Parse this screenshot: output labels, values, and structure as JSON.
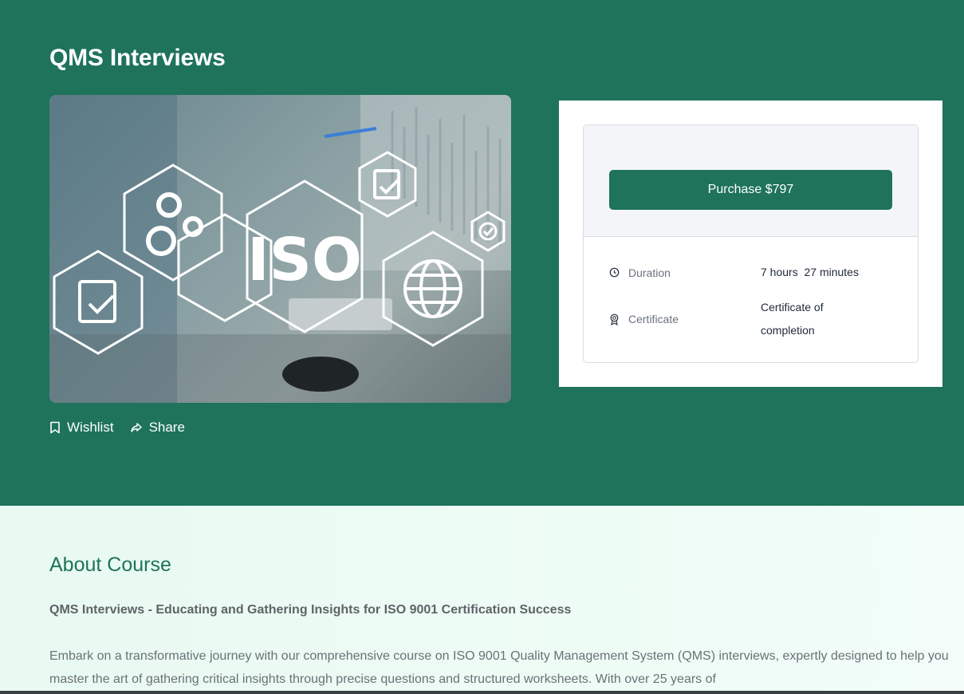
{
  "course": {
    "title": "QMS Interviews",
    "thumbnail_text": "ISO"
  },
  "actions": {
    "wishlist_label": "Wishlist",
    "share_label": "Share"
  },
  "purchase": {
    "button_label": "Purchase $797",
    "duration_label": "Duration",
    "duration_value": "7 hours  27 minutes",
    "certificate_label": "Certificate",
    "certificate_value": "Certificate of completion"
  },
  "about": {
    "heading": "About Course",
    "subtitle": "QMS Interviews - Educating and Gathering Insights for ISO 9001 Certification Success",
    "body": "Embark on a transformative journey with our comprehensive course on ISO 9001 Quality Management System (QMS) interviews, expertly designed to help you master the art of gathering critical insights through precise questions and structured worksheets. With over 25 years of"
  },
  "colors": {
    "brand": "#1e735a",
    "about_bg": "#effcf6",
    "card_bg": "#ffffff"
  },
  "icons": {
    "wishlist": "bookmark-icon",
    "share": "share-icon",
    "duration": "clock-icon",
    "certificate": "award-icon"
  }
}
